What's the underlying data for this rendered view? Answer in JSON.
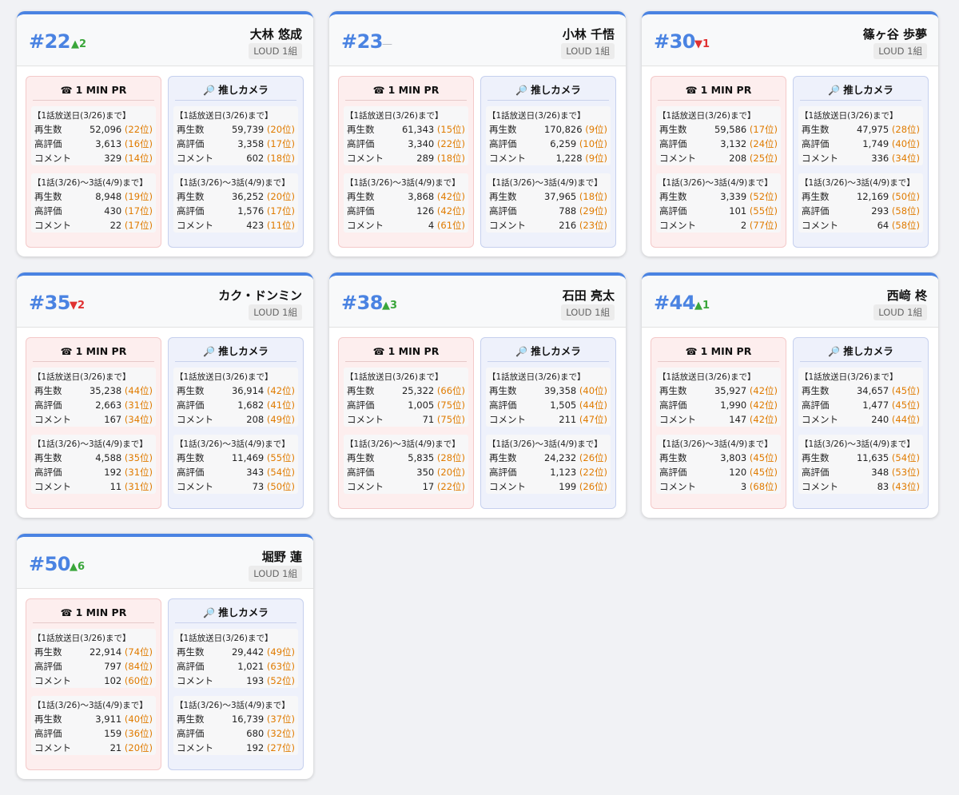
{
  "colors": {
    "accent": "#4a83e2",
    "up": "#3aa63a",
    "down": "#e03131",
    "rank_text": "#e07b00",
    "pr_bg": "#fdeeee",
    "cam_bg": "#eef1fb"
  },
  "labels": {
    "pr_icon": "☎",
    "pr_title": "1 MIN PR",
    "cam_icon": "🔎",
    "cam_title": "推しカメラ",
    "period1": "【1話放送日(3/26)まで】",
    "period2": "【1話(3/26)〜3話(4/9)まで】",
    "views": "再生数",
    "likes": "高評価",
    "comments": "コメント"
  },
  "cards": [
    {
      "rank": "#22",
      "change": "▲2",
      "change_dir": "up",
      "name": "大林 悠成",
      "group": "LOUD 1組",
      "pr": [
        [
          [
            "52,096",
            "(22位)"
          ],
          [
            "3,613",
            "(16位)"
          ],
          [
            "329",
            "(14位)"
          ]
        ],
        [
          [
            "8,948",
            "(19位)"
          ],
          [
            "430",
            "(17位)"
          ],
          [
            "22",
            "(17位)"
          ]
        ]
      ],
      "cam": [
        [
          [
            "59,739",
            "(20位)"
          ],
          [
            "3,358",
            "(17位)"
          ],
          [
            "602",
            "(18位)"
          ]
        ],
        [
          [
            "36,252",
            "(20位)"
          ],
          [
            "1,576",
            "(17位)"
          ],
          [
            "423",
            "(11位)"
          ]
        ]
      ]
    },
    {
      "rank": "#23",
      "change": "—",
      "change_dir": "flat",
      "name": "小林 千悟",
      "group": "LOUD 1組",
      "pr": [
        [
          [
            "61,343",
            "(15位)"
          ],
          [
            "3,340",
            "(22位)"
          ],
          [
            "289",
            "(18位)"
          ]
        ],
        [
          [
            "3,868",
            "(42位)"
          ],
          [
            "126",
            "(42位)"
          ],
          [
            "4",
            "(61位)"
          ]
        ]
      ],
      "cam": [
        [
          [
            "170,826",
            "(9位)"
          ],
          [
            "6,259",
            "(10位)"
          ],
          [
            "1,228",
            "(9位)"
          ]
        ],
        [
          [
            "37,965",
            "(18位)"
          ],
          [
            "788",
            "(29位)"
          ],
          [
            "216",
            "(23位)"
          ]
        ]
      ]
    },
    {
      "rank": "#30",
      "change": "▼1",
      "change_dir": "down",
      "name": "篠ヶ谷 歩夢",
      "group": "LOUD 1組",
      "pr": [
        [
          [
            "59,586",
            "(17位)"
          ],
          [
            "3,132",
            "(24位)"
          ],
          [
            "208",
            "(25位)"
          ]
        ],
        [
          [
            "3,339",
            "(52位)"
          ],
          [
            "101",
            "(55位)"
          ],
          [
            "2",
            "(77位)"
          ]
        ]
      ],
      "cam": [
        [
          [
            "47,975",
            "(28位)"
          ],
          [
            "1,749",
            "(40位)"
          ],
          [
            "336",
            "(34位)"
          ]
        ],
        [
          [
            "12,169",
            "(50位)"
          ],
          [
            "293",
            "(58位)"
          ],
          [
            "64",
            "(58位)"
          ]
        ]
      ]
    },
    {
      "rank": "#35",
      "change": "▼2",
      "change_dir": "down",
      "name": "カク・ドンミン",
      "group": "LOUD 1組",
      "pr": [
        [
          [
            "35,238",
            "(44位)"
          ],
          [
            "2,663",
            "(31位)"
          ],
          [
            "167",
            "(34位)"
          ]
        ],
        [
          [
            "4,588",
            "(35位)"
          ],
          [
            "192",
            "(31位)"
          ],
          [
            "11",
            "(31位)"
          ]
        ]
      ],
      "cam": [
        [
          [
            "36,914",
            "(42位)"
          ],
          [
            "1,682",
            "(41位)"
          ],
          [
            "208",
            "(49位)"
          ]
        ],
        [
          [
            "11,469",
            "(55位)"
          ],
          [
            "343",
            "(54位)"
          ],
          [
            "73",
            "(50位)"
          ]
        ]
      ]
    },
    {
      "rank": "#38",
      "change": "▲3",
      "change_dir": "up",
      "name": "石田 亮太",
      "group": "LOUD 1組",
      "pr": [
        [
          [
            "25,322",
            "(66位)"
          ],
          [
            "1,005",
            "(75位)"
          ],
          [
            "71",
            "(75位)"
          ]
        ],
        [
          [
            "5,835",
            "(28位)"
          ],
          [
            "350",
            "(20位)"
          ],
          [
            "17",
            "(22位)"
          ]
        ]
      ],
      "cam": [
        [
          [
            "39,358",
            "(40位)"
          ],
          [
            "1,505",
            "(44位)"
          ],
          [
            "211",
            "(47位)"
          ]
        ],
        [
          [
            "24,232",
            "(26位)"
          ],
          [
            "1,123",
            "(22位)"
          ],
          [
            "199",
            "(26位)"
          ]
        ]
      ]
    },
    {
      "rank": "#44",
      "change": "▲1",
      "change_dir": "up",
      "name": "西﨑 柊",
      "group": "LOUD 1組",
      "pr": [
        [
          [
            "35,927",
            "(42位)"
          ],
          [
            "1,990",
            "(42位)"
          ],
          [
            "147",
            "(42位)"
          ]
        ],
        [
          [
            "3,803",
            "(45位)"
          ],
          [
            "120",
            "(45位)"
          ],
          [
            "3",
            "(68位)"
          ]
        ]
      ],
      "cam": [
        [
          [
            "34,657",
            "(45位)"
          ],
          [
            "1,477",
            "(45位)"
          ],
          [
            "240",
            "(44位)"
          ]
        ],
        [
          [
            "11,635",
            "(54位)"
          ],
          [
            "348",
            "(53位)"
          ],
          [
            "83",
            "(43位)"
          ]
        ]
      ]
    },
    {
      "rank": "#50",
      "change": "▲6",
      "change_dir": "up",
      "name": "堀野 蓮",
      "group": "LOUD 1組",
      "pr": [
        [
          [
            "22,914",
            "(74位)"
          ],
          [
            "797",
            "(84位)"
          ],
          [
            "102",
            "(60位)"
          ]
        ],
        [
          [
            "3,911",
            "(40位)"
          ],
          [
            "159",
            "(36位)"
          ],
          [
            "21",
            "(20位)"
          ]
        ]
      ],
      "cam": [
        [
          [
            "29,442",
            "(49位)"
          ],
          [
            "1,021",
            "(63位)"
          ],
          [
            "193",
            "(52位)"
          ]
        ],
        [
          [
            "16,739",
            "(37位)"
          ],
          [
            "680",
            "(32位)"
          ],
          [
            "192",
            "(27位)"
          ]
        ]
      ]
    }
  ]
}
